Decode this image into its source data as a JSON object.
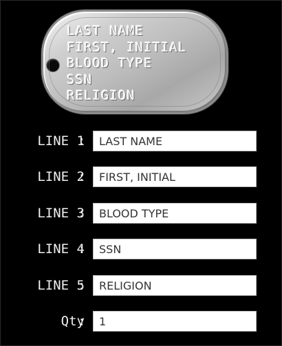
{
  "tag": {
    "lines": [
      "LAST NAME",
      "FIRST, INITIAL",
      "BLOOD TYPE",
      "SSN",
      "RELIGION"
    ]
  },
  "form": {
    "colon": ":",
    "line1": {
      "label": "LINE 1",
      "value": "LAST NAME"
    },
    "line2": {
      "label": "LINE 2",
      "value": "FIRST, INITIAL"
    },
    "line3": {
      "label": "LINE 3",
      "value": "BLOOD TYPE"
    },
    "line4": {
      "label": "LINE 4",
      "value": "SSN"
    },
    "line5": {
      "label": "LINE 5",
      "value": "RELIGION"
    },
    "qty": {
      "label": "Qty",
      "value": "1"
    }
  },
  "colors": {
    "background": "#000000",
    "label_text": "#f0f0f0",
    "field_background": "#ffffff",
    "field_text": "#333333"
  }
}
